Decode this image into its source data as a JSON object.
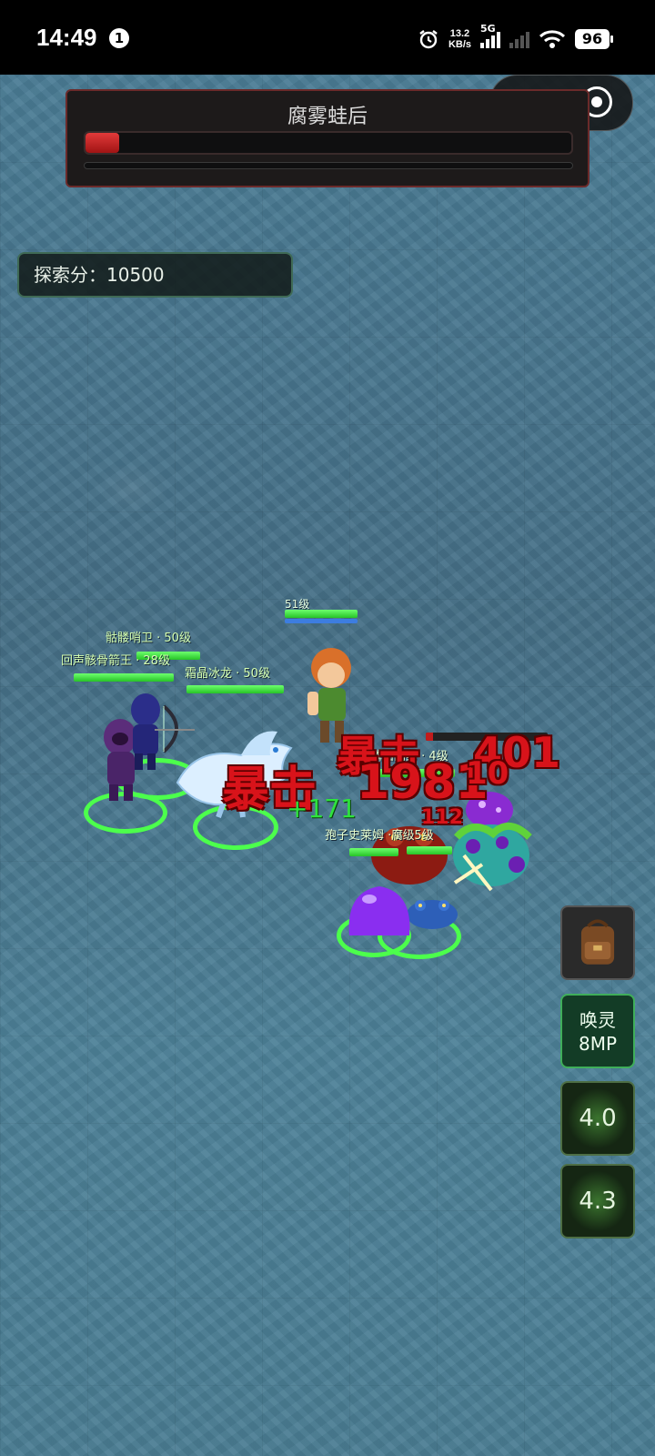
{
  "status_bar": {
    "time": "14:49",
    "notification_count": "1",
    "net_speed_value": "13.2",
    "net_speed_unit": "KB/s",
    "network": "5G",
    "battery": "96"
  },
  "boss": {
    "name": "腐雾蛙后",
    "hp_fraction": 0.07
  },
  "score": {
    "text": "探索分：10500"
  },
  "units": {
    "skeleton_guard": {
      "label": "骷髅哨卫 · 50级"
    },
    "echo_archer_king": {
      "label": "回声骸骨箭王 · 28级"
    },
    "frost_dragon": {
      "label": "霜晶冰龙 · 50级"
    },
    "hero": {
      "label": "51级"
    },
    "lava_croc": {
      "label": "熔鳞沼门鳄 · 4级"
    },
    "spore_slime": {
      "label": "孢子史莱姆 · 5级"
    },
    "rot_enemy": {
      "label": "腐 · 5级"
    }
  },
  "combat_text": {
    "crit_1": "暴击",
    "crit_2": "暴击",
    "dmg_1": "1981",
    "dmg_2": "401",
    "dmg_3": "10",
    "dmg_4": "112",
    "heal": "+171"
  },
  "buttons": {
    "summon_line1": "唤灵",
    "summon_line2": "8MP",
    "skill_1_cd": "4.0",
    "skill_2_cd": "4.3"
  },
  "colors": {
    "hp": "#27c327",
    "boss_hp": "#d42525",
    "crit": "#d8131a",
    "ring": "#4cff4c"
  }
}
